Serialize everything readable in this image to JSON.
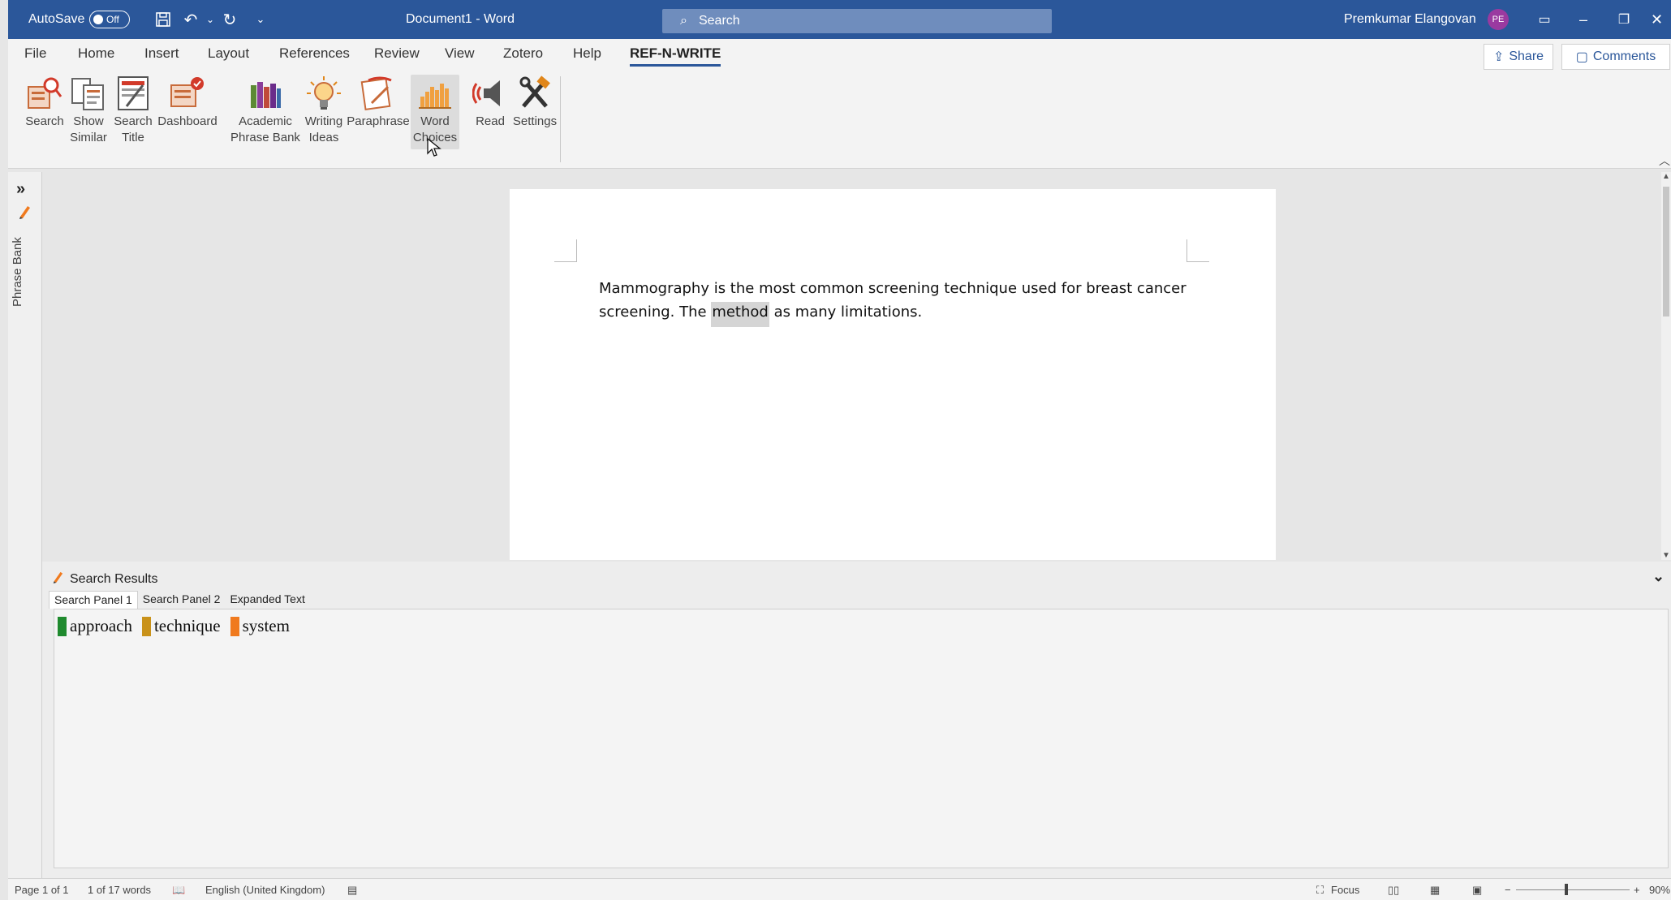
{
  "titlebar": {
    "autosave_label": "AutoSave",
    "autosave_state": "Off",
    "doc_title": "Document1  -  Word",
    "search_placeholder": "Search",
    "user_name": "Premkumar Elangovan",
    "user_initials": "PE",
    "background": "#2b579a"
  },
  "ribbon": {
    "tabs": [
      "File",
      "Home",
      "Insert",
      "Layout",
      "References",
      "Review",
      "View",
      "Zotero",
      "Help",
      "REF-N-WRITE"
    ],
    "active_tab": "REF-N-WRITE",
    "share_label": "Share",
    "comments_label": "Comments",
    "commands": [
      {
        "line1": "Search",
        "line2": "",
        "icon": "search-icon"
      },
      {
        "line1": "Show",
        "line2": "Similar",
        "icon": "show-similar-icon"
      },
      {
        "line1": "Search",
        "line2": "Title",
        "icon": "search-title-icon"
      },
      {
        "line1": "Dashboard",
        "line2": "",
        "icon": "dashboard-icon"
      },
      {
        "line1": "Academic",
        "line2": "Phrase Bank",
        "icon": "books-icon"
      },
      {
        "line1": "Writing",
        "line2": "Ideas",
        "icon": "lightbulb-icon"
      },
      {
        "line1": "Paraphrase",
        "line2": "",
        "icon": "paraphrase-icon"
      },
      {
        "line1": "Word",
        "line2": "Choices",
        "icon": "bar-chart-icon"
      },
      {
        "line1": "Read",
        "line2": "",
        "icon": "speaker-icon"
      },
      {
        "line1": "Settings",
        "line2": "",
        "icon": "tools-icon"
      }
    ]
  },
  "sidebar": {
    "label": "Phrase Bank"
  },
  "document": {
    "text_before": "Mammography is the most common screening technique used for breast cancer screening. The ",
    "highlighted_word": "method",
    "text_after": " as many limitations."
  },
  "results": {
    "title": "Search Results",
    "tabs": [
      "Search Panel 1",
      "Search Panel 2",
      "Expanded Text"
    ],
    "active_tab": "Search Panel 1",
    "words": [
      {
        "word": "approach",
        "color": "#1f8a2e"
      },
      {
        "word": "technique",
        "color": "#c9921a"
      },
      {
        "word": "system",
        "color": "#f07a1e"
      }
    ]
  },
  "statusbar": {
    "page": "Page 1 of 1",
    "words": "1 of 17 words",
    "language": "English (United Kingdom)",
    "focus": "Focus",
    "zoom_minus": "−",
    "zoom_plus": "+",
    "zoom": "90%"
  }
}
